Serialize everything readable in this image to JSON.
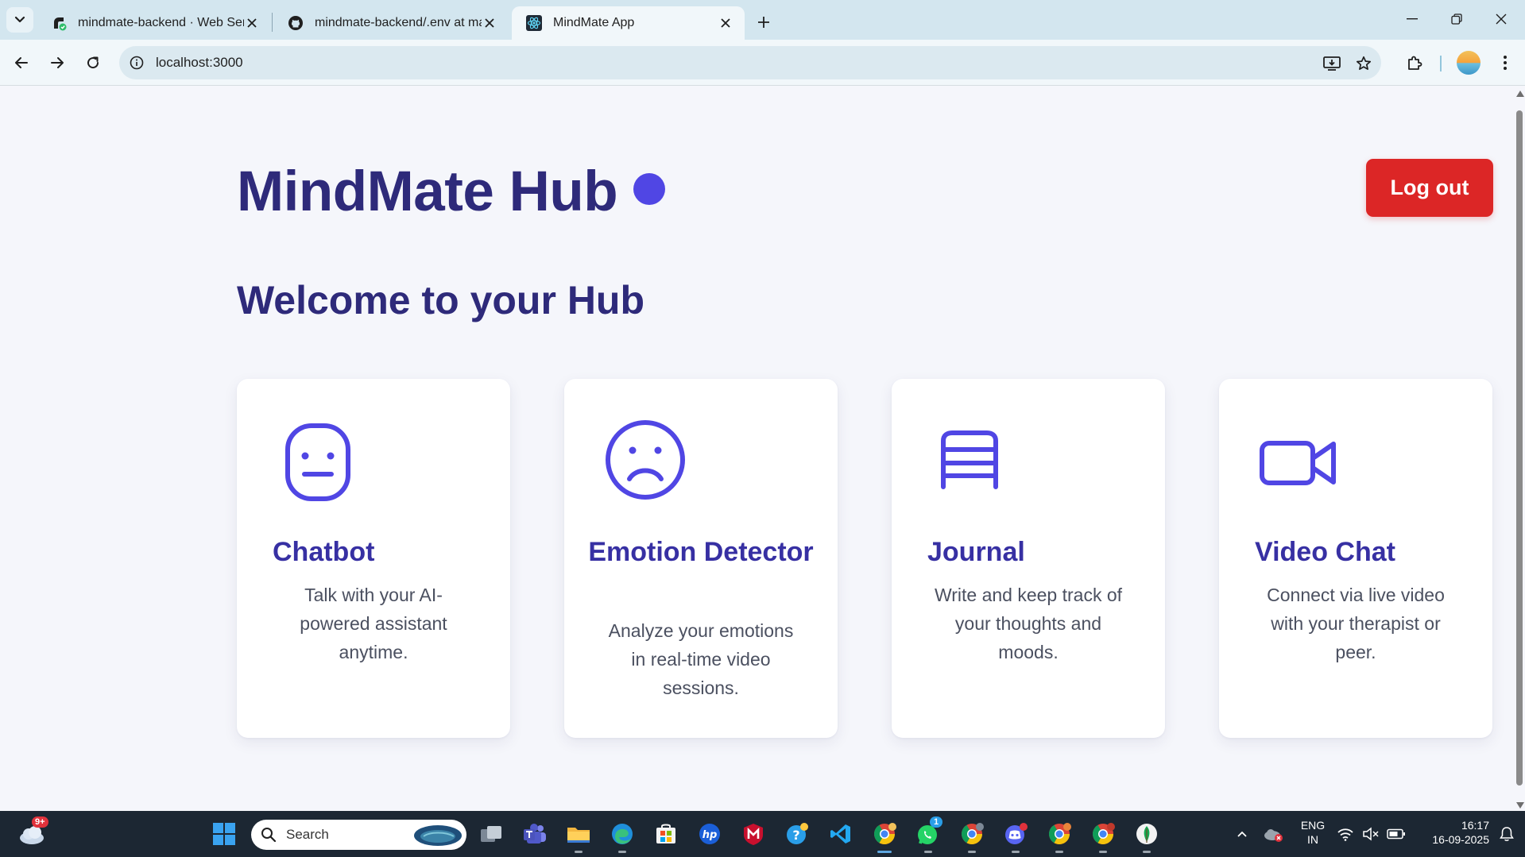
{
  "browser": {
    "tabs": [
      {
        "title": "mindmate-backend · Web Serv",
        "active": false
      },
      {
        "title": "mindmate-backend/.env at mai",
        "active": false
      },
      {
        "title": "MindMate App",
        "active": true
      }
    ],
    "url": "localhost:3000"
  },
  "page": {
    "hub_title": "MindMate Hub",
    "logout_label": "Log out",
    "welcome": "Welcome to your Hub",
    "cards": [
      {
        "title": "Chatbot",
        "description": "Talk with your AI-powered assistant anytime.",
        "icon": "neutral-face-icon"
      },
      {
        "title": "Emotion Detector",
        "description": "Analyze your emotions in real-time video sessions.",
        "icon": "sad-face-icon"
      },
      {
        "title": "Journal",
        "description": "Write and keep track of your thoughts and moods.",
        "icon": "journal-icon"
      },
      {
        "title": "Video Chat",
        "description": "Connect via live video with your therapist or peer.",
        "icon": "video-camera-icon"
      }
    ],
    "colors": {
      "accent": "#5046e4",
      "title": "#2e2a7a",
      "card_title": "#3730a3",
      "logout": "#dc2626"
    }
  },
  "taskbar": {
    "search_label": "Search",
    "weather_badge": "9+",
    "whatsapp_badge": "1",
    "language": "ENG",
    "region": "IN",
    "time": "16:17",
    "date": "16-09-2025"
  }
}
